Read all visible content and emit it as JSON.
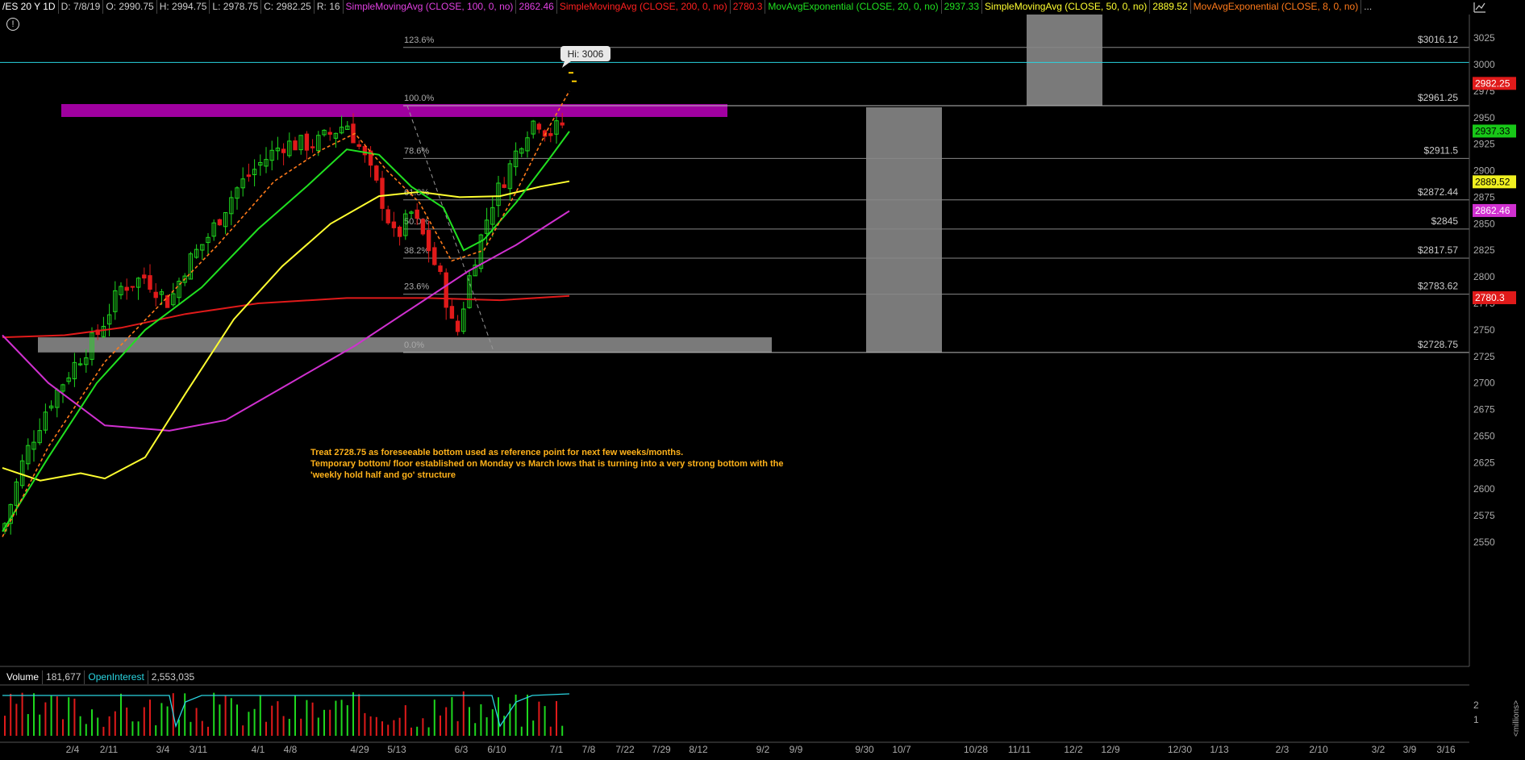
{
  "header": {
    "symbol": "/ES 20 Y 1D",
    "date": "D: 7/8/19",
    "open": "O: 2990.75",
    "high": "H: 2994.75",
    "low": "L: 2978.75",
    "close": "C: 2982.25",
    "range": "R: 16",
    "studies": [
      {
        "label": "SimpleMovingAvg (CLOSE, 100, 0, no)",
        "value": "2862.46",
        "color": "#e040e0"
      },
      {
        "label": "SimpleMovingAvg (CLOSE, 200, 0, no)",
        "value": "2780.3",
        "color": "#ff2020"
      },
      {
        "label": "MovAvgExponential (CLOSE, 20, 0, no)",
        "value": "2937.33",
        "color": "#20e020"
      },
      {
        "label": "SimpleMovingAvg (CLOSE, 50, 0, no)",
        "value": "2889.52",
        "color": "#ffff30"
      },
      {
        "label": "MovAvgExponential (CLOSE, 8, 0, no)",
        "value": "",
        "color": "#ff7a1a"
      }
    ],
    "more": "..."
  },
  "info_icon": "info-icon",
  "hi_callout": "Hi: 3006",
  "price_axis": {
    "ticks": [
      3025,
      3000,
      2975,
      2950,
      2925,
      2900,
      2875,
      2850,
      2825,
      2800,
      2775,
      2750,
      2725,
      2700,
      2675,
      2650,
      2625,
      2600,
      2575,
      2550
    ],
    "badges": [
      {
        "text": "2982.25",
        "value": 2982.25,
        "bg": "#e01a1a",
        "fg": "#ffffff"
      },
      {
        "text": "2937.33",
        "value": 2937.33,
        "bg": "#18c818",
        "fg": "#000000"
      },
      {
        "text": "2889.52",
        "value": 2889.52,
        "bg": "#f0f020",
        "fg": "#000000"
      },
      {
        "text": "2862.46",
        "value": 2862.46,
        "bg": "#d030d0",
        "fg": "#ffffff"
      },
      {
        "text": "2780.3",
        "value": 2780.3,
        "bg": "#e01a1a",
        "fg": "#ffffff"
      }
    ]
  },
  "fib_levels": [
    {
      "pct": "123.6%",
      "price": 3016.12,
      "label": "$3016.12"
    },
    {
      "pct": "100.0%",
      "price": 2961.25,
      "label": "$2961.25"
    },
    {
      "pct": "78.6%",
      "price": 2911.5,
      "label": "$2911.5"
    },
    {
      "pct": "61.8%",
      "price": 2872.44,
      "label": "$2872.44"
    },
    {
      "pct": "50.0%",
      "price": 2845,
      "label": "$2845"
    },
    {
      "pct": "38.2%",
      "price": 2817.57,
      "label": "$2817.57"
    },
    {
      "pct": "23.6%",
      "price": 2783.62,
      "label": "$2783.62"
    },
    {
      "pct": "0.0%",
      "price": 2728.75,
      "label": "$2728.75"
    }
  ],
  "annotation": {
    "line1": "Treat 2728.75 as foreseeable bottom used as reference point for next few weeks/months.",
    "line2": "Temporary bottom/ floor established on Monday vs March lows that is turning into a very strong bottom with the",
    "line3": "'weekly hold half and go' structure"
  },
  "volume_panel": {
    "volume_label": "Volume",
    "volume_value": "181,677",
    "oi_label": "OpenInterest",
    "oi_value": "2,553,035",
    "axis_ticks": [
      "2",
      "1"
    ],
    "units": "<millions>"
  },
  "x_axis": [
    "2/4",
    "2/11",
    "3/4",
    "3/11",
    "4/1",
    "4/8",
    "4/29",
    "5/13",
    "6/3",
    "6/10",
    "7/1",
    "7/8",
    "7/22",
    "7/29",
    "8/12",
    "9/2",
    "9/9",
    "9/30",
    "10/7",
    "10/28",
    "11/11",
    "12/2",
    "12/9",
    "12/30",
    "1/13",
    "2/3",
    "2/10",
    "3/2",
    "3/9",
    "3/16"
  ],
  "colors": {
    "up": "#1ed81e",
    "down": "#e01a1a",
    "sma100": "#d030d0",
    "sma200": "#e01a1a",
    "ema20": "#20e020",
    "sma50": "#ffff30",
    "ema8": "#ff7a1a",
    "zone_magenta": "#a000a0",
    "zone_grey": "#7a7a7a",
    "cyan_line": "#2ad4e0",
    "annotation": "#ffb21a"
  }
}
